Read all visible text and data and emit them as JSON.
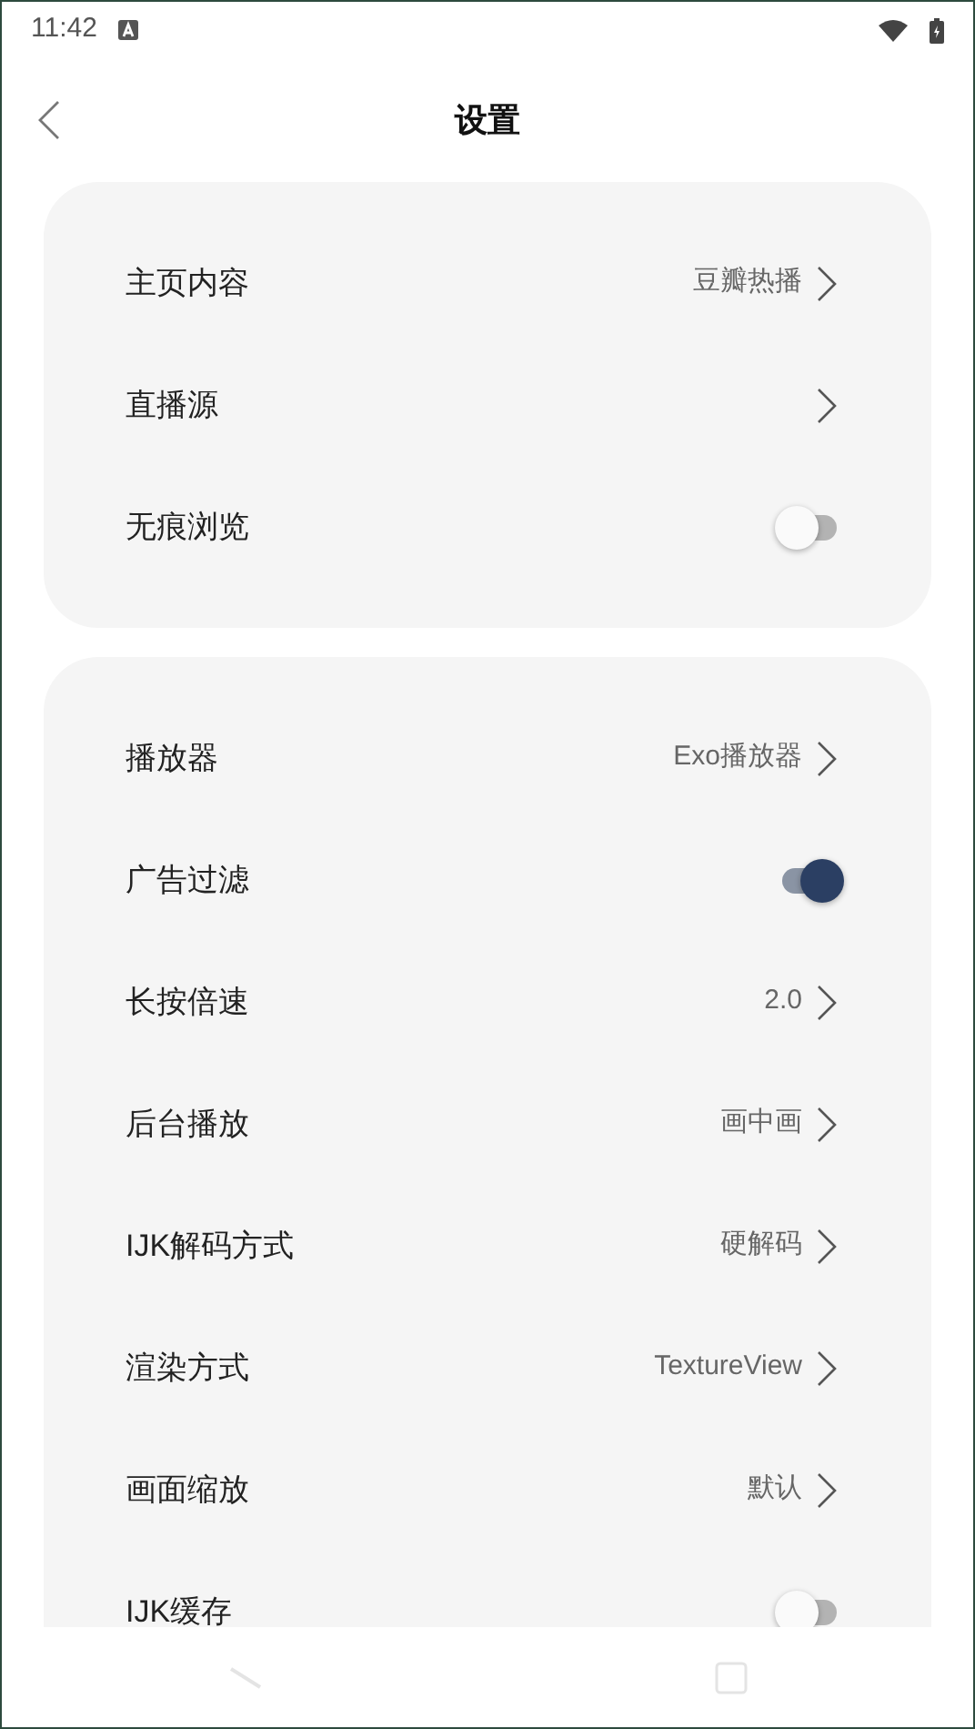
{
  "status_bar": {
    "time": "11:42"
  },
  "header": {
    "title": "设置"
  },
  "groups": [
    {
      "items": [
        {
          "kind": "nav",
          "label": "主页内容",
          "value": "豆瓣热播"
        },
        {
          "kind": "nav",
          "label": "直播源"
        },
        {
          "kind": "toggle",
          "label": "无痕浏览",
          "on": false
        }
      ]
    },
    {
      "items": [
        {
          "kind": "nav",
          "label": "播放器",
          "value": "Exo播放器"
        },
        {
          "kind": "toggle",
          "label": "广告过滤",
          "on": true
        },
        {
          "kind": "nav",
          "label": "长按倍速",
          "value": "2.0"
        },
        {
          "kind": "nav",
          "label": "后台播放",
          "value": "画中画"
        },
        {
          "kind": "nav",
          "label": "IJK解码方式",
          "value": "硬解码"
        },
        {
          "kind": "nav",
          "label": "渲染方式",
          "value": "TextureView"
        },
        {
          "kind": "nav",
          "label": "画面缩放",
          "value": "默认"
        },
        {
          "kind": "toggle",
          "label": "IJK缓存",
          "on": false
        }
      ]
    }
  ]
}
